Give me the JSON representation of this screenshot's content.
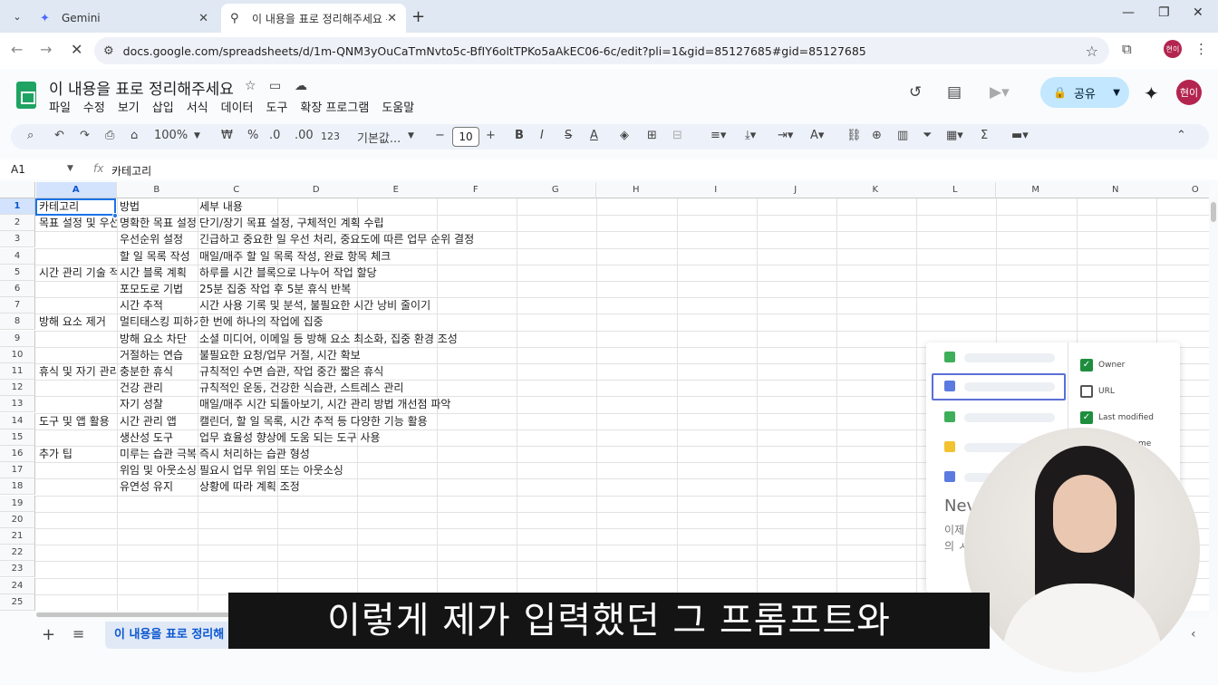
{
  "browser": {
    "tabs": [
      {
        "title": "Gemini",
        "icon": "gemini-sparkle-icon",
        "active": false
      },
      {
        "title": "이 내용을 표로 정리해주세요 -",
        "icon": "sheets-tab-icon",
        "active": true
      }
    ],
    "url": "docs.google.com/spreadsheets/d/1m-QNM3yOuCaTmNvto5c-BfIY6oltTPKo5aAkEC06-6c/edit?pli=1&gid=85127685#gid=85127685",
    "profile_initial": "현이"
  },
  "sheets": {
    "doc_title": "이 내용을 표로 정리해주세요",
    "menus": [
      "파일",
      "수정",
      "보기",
      "삽입",
      "서식",
      "데이터",
      "도구",
      "확장 프로그램",
      "도움말"
    ],
    "share_label": "공유",
    "user_initial": "현이"
  },
  "toolbar": {
    "zoom": "100%",
    "currency": "₩",
    "percent": "%",
    "dec_decrease": ".0",
    "dec_increase": ".00",
    "number_format": "123",
    "font": "기본값...",
    "font_size": "10"
  },
  "formula_bar": {
    "cell_ref": "A1",
    "value": "카테고리"
  },
  "grid": {
    "columns": [
      "A",
      "B",
      "C",
      "D",
      "E",
      "F",
      "G",
      "H",
      "I",
      "J",
      "K",
      "L",
      "M",
      "N",
      "O"
    ],
    "row_numbers": [
      "1",
      "2",
      "3",
      "4",
      "5",
      "6",
      "7",
      "8",
      "9",
      "10",
      "11",
      "12",
      "13",
      "14",
      "15",
      "16",
      "17",
      "18",
      "19",
      "20",
      "21",
      "22",
      "23",
      "24",
      "25"
    ],
    "rows": [
      [
        "카테고리",
        "방법",
        "세부 내용"
      ],
      [
        "목표 설정 및 우선",
        "명확한 목표 설정",
        "단기/장기 목표 설정, 구체적인 계획 수립"
      ],
      [
        "",
        "우선순위 설정",
        "긴급하고 중요한 일 우선 처리, 중요도에 따른 업무 순위 결정"
      ],
      [
        "",
        "할 일 목록 작성",
        "매일/매주 할 일 목록 작성, 완료 항목 체크"
      ],
      [
        "시간 관리 기술 적",
        "시간 블록 계획",
        "하루를 시간 블록으로 나누어 작업 할당"
      ],
      [
        "",
        "포모도로 기법",
        "25분 집중 작업 후 5분 휴식 반복"
      ],
      [
        "",
        "시간 추적",
        "시간 사용 기록 및 분석, 불필요한 시간 낭비 줄이기"
      ],
      [
        "방해 요소 제거",
        "멀티태스킹 피하기",
        "한 번에 하나의 작업에 집중"
      ],
      [
        "",
        "방해 요소 차단",
        "소셜 미디어, 이메일 등 방해 요소 최소화, 집중 환경 조성"
      ],
      [
        "",
        "거절하는 연습",
        "불필요한 요청/업무 거절, 시간 확보"
      ],
      [
        "휴식 및 자기 관리",
        "충분한 휴식",
        "규칙적인 수면 습관, 작업 중간 짧은 휴식"
      ],
      [
        "",
        "건강 관리",
        "규칙적인 운동, 건강한 식습관, 스트레스 관리"
      ],
      [
        "",
        "자기 성찰",
        "매일/매주 시간 되돌아보기, 시간 관리 방법 개선점 파악"
      ],
      [
        "도구 및 앱 활용",
        "시간 관리 앱",
        "캘린더, 할 일 목록, 시간 추적 등 다양한 기능 활용"
      ],
      [
        "",
        "생산성 도구",
        "업무 효율성 향상에 도움 되는 도구 사용"
      ],
      [
        "추가 팁",
        "미루는 습관 극복",
        "즉시 처리하는 습관 형성"
      ],
      [
        "",
        "위임 및 아웃소싱",
        "필요시 업무 위임 또는 아웃소싱"
      ],
      [
        "",
        "유연성 유지",
        "상황에 따라 계획 조정"
      ]
    ]
  },
  "sheet_tab": "이 내용을 표로 정리해",
  "overlay_card": {
    "options": [
      {
        "label": "Owner",
        "checked": true
      },
      {
        "label": "URL",
        "checked": false
      },
      {
        "label": "Last modified",
        "checked": true
      },
      {
        "label": "me",
        "checked": false
      }
    ],
    "big_text": "Nev",
    "line1": "이제",
    "line2": "의 ㅅ"
  },
  "subtitle": "이렇게 제가 입력했던 그 프롬프트와"
}
